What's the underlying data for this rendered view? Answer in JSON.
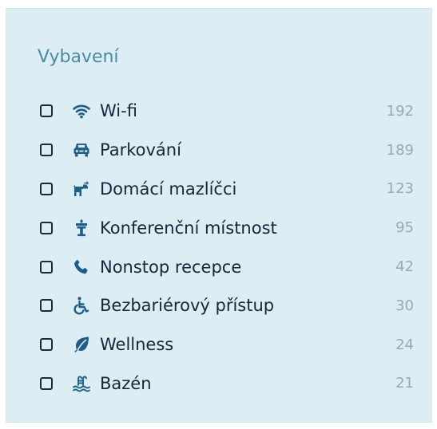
{
  "filter": {
    "title": "Vybavení",
    "items": [
      {
        "label": "Wi-fi",
        "count": "192",
        "icon": "wifi-icon",
        "checked": false
      },
      {
        "label": "Parkování",
        "count": "189",
        "icon": "car-icon",
        "checked": false
      },
      {
        "label": "Domácí mazlíčci",
        "count": "123",
        "icon": "dog-icon",
        "checked": false
      },
      {
        "label": "Konferenční místnost",
        "count": "95",
        "icon": "podium-icon",
        "checked": false
      },
      {
        "label": "Nonstop recepce",
        "count": "42",
        "icon": "phone-icon",
        "checked": false
      },
      {
        "label": "Bezbariérový přístup",
        "count": "30",
        "icon": "wheelchair-icon",
        "checked": false
      },
      {
        "label": "Wellness",
        "count": "24",
        "icon": "leaf-icon",
        "checked": false
      },
      {
        "label": "Bazén",
        "count": "21",
        "icon": "pool-icon",
        "checked": false
      }
    ]
  },
  "colors": {
    "panel_bg": "#dcedf4",
    "title": "#4a8aa6",
    "icon": "#1e5f8a",
    "text": "#15283a",
    "count": "#9aa9b3"
  }
}
